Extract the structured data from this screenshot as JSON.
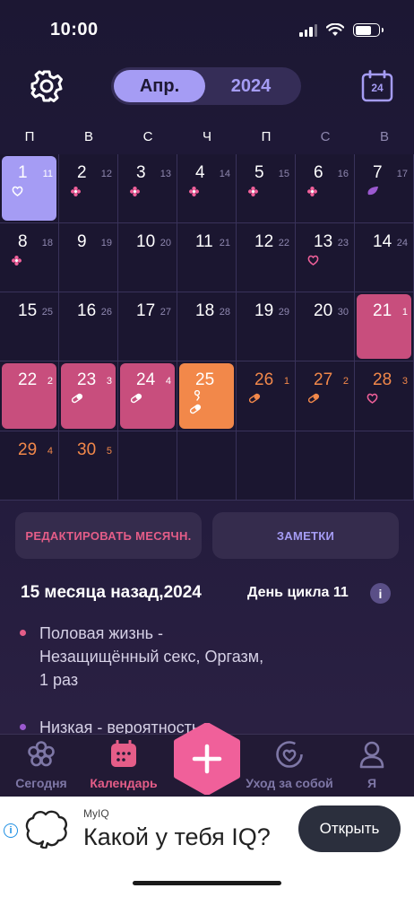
{
  "status": {
    "time": "10:00"
  },
  "header": {
    "month_label": "Апр.",
    "year_label": "2024",
    "today_num": "24"
  },
  "weekdays": [
    "П",
    "В",
    "С",
    "Ч",
    "П",
    "С",
    "В"
  ],
  "days": [
    {
      "d": "1",
      "c": "11",
      "style": "purple",
      "marker": "heart"
    },
    {
      "d": "2",
      "c": "12",
      "marker": "flower"
    },
    {
      "d": "3",
      "c": "13",
      "marker": "flower"
    },
    {
      "d": "4",
      "c": "14",
      "marker": "flower"
    },
    {
      "d": "5",
      "c": "15",
      "marker": "flower"
    },
    {
      "d": "6",
      "c": "16",
      "marker": "flower"
    },
    {
      "d": "7",
      "c": "17",
      "marker": "drop"
    },
    {
      "d": "8",
      "c": "18",
      "marker": "flower"
    },
    {
      "d": "9",
      "c": "19"
    },
    {
      "d": "10",
      "c": "20"
    },
    {
      "d": "11",
      "c": "21"
    },
    {
      "d": "12",
      "c": "22"
    },
    {
      "d": "13",
      "c": "23",
      "marker": "heart-pink"
    },
    {
      "d": "14",
      "c": "24"
    },
    {
      "d": "15",
      "c": "25"
    },
    {
      "d": "16",
      "c": "26"
    },
    {
      "d": "17",
      "c": "27"
    },
    {
      "d": "18",
      "c": "28"
    },
    {
      "d": "19",
      "c": "29"
    },
    {
      "d": "20",
      "c": "30"
    },
    {
      "d": "21",
      "c": "1",
      "style": "pink"
    },
    {
      "d": "22",
      "c": "2",
      "style": "pink"
    },
    {
      "d": "23",
      "c": "3",
      "style": "pink",
      "marker": "pill-white"
    },
    {
      "d": "24",
      "c": "4",
      "style": "pink",
      "marker": "pill-white"
    },
    {
      "d": "25",
      "c": "",
      "style": "orange",
      "marker": "pill-white",
      "extra": "fertility"
    },
    {
      "d": "26",
      "c": "1",
      "style": "orange-text",
      "marker": "pill-orange"
    },
    {
      "d": "27",
      "c": "2",
      "style": "orange-text",
      "marker": "pill-orange"
    },
    {
      "d": "28",
      "c": "3",
      "style": "orange-text",
      "marker": "heart-pink"
    },
    {
      "d": "29",
      "c": "4",
      "style": "orange-text"
    },
    {
      "d": "30",
      "c": "5",
      "style": "orange-text"
    }
  ],
  "buttons": {
    "edit_label": "РЕДАКТИРОВАТЬ МЕСЯЧН.",
    "notes_label": "ЗАМЕТКИ"
  },
  "info": {
    "title": "15 месяца назад,2024",
    "cycle_day": "День цикла 11",
    "info_icon": "i"
  },
  "details": [
    {
      "text": "Половая жизнь - Незащищённый секс, Оргазм, 1 раз",
      "color": "#e55d88"
    },
    {
      "text": "Низкая - вероятность",
      "color": "#9b59d0"
    }
  ],
  "tabs": [
    {
      "label": "Сегодня",
      "icon": "flower-icon"
    },
    {
      "label": "Календарь",
      "icon": "calendar-icon"
    },
    {
      "label": "Уход за собой",
      "icon": "heart-circle-icon"
    },
    {
      "label": "Я",
      "icon": "person-icon"
    }
  ],
  "ad": {
    "brand": "MyIQ",
    "headline": "Какой у тебя IQ?",
    "cta": "Открыть",
    "info": "i"
  },
  "colors": {
    "accent_purple": "#a59cf4",
    "period_pink": "#c84e7d",
    "fertile_orange": "#f2884a",
    "tab_active": "#e55d88"
  }
}
